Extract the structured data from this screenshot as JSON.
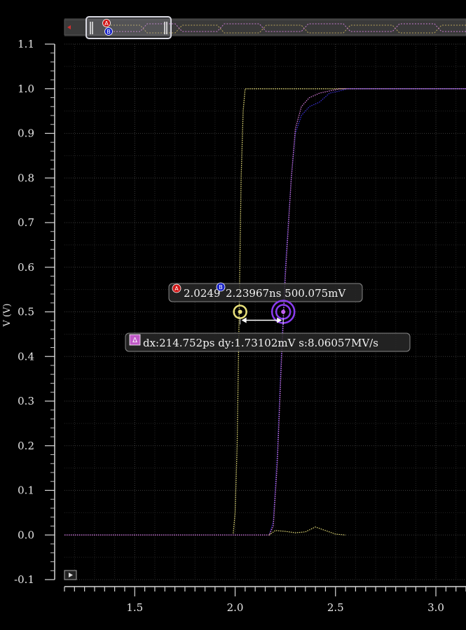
{
  "chart_data": {
    "type": "line",
    "ylabel": "V (V)",
    "xlabel": "",
    "xlim": [
      1.15,
      3.15
    ],
    "ylim": [
      -0.1,
      1.1
    ],
    "x_ticks": [
      "1.5",
      "2.0",
      "2.5",
      "3.0"
    ],
    "y_ticks": [
      "-0.1",
      "0.0",
      "0.1",
      "0.2",
      "0.3",
      "0.4",
      "0.5",
      "0.6",
      "0.7",
      "0.8",
      "0.9",
      "1.0",
      "1.1"
    ],
    "grid": true,
    "series": [
      {
        "color": "#e8e07a",
        "x": [
          1.15,
          1.99,
          2.0,
          2.01,
          2.02,
          2.03,
          2.04,
          2.05,
          3.15
        ],
        "y": [
          0.0,
          0.0,
          0.05,
          0.2,
          0.5,
          0.8,
          0.95,
          1.0,
          1.0
        ]
      },
      {
        "color": "#3a2fd6",
        "x": [
          1.15,
          2.17,
          2.19,
          2.21,
          2.23,
          2.25,
          2.28,
          2.3,
          2.33,
          2.37,
          2.42,
          2.47,
          2.52,
          2.56,
          2.6,
          3.15
        ],
        "y": [
          0.0,
          0.0,
          0.03,
          0.18,
          0.4,
          0.6,
          0.8,
          0.9,
          0.94,
          0.96,
          0.97,
          0.99,
          0.995,
          1.0,
          1.0,
          1.0
        ]
      },
      {
        "color": "#d27ad8",
        "x": [
          1.15,
          2.17,
          2.19,
          2.21,
          2.23,
          2.25,
          2.28,
          2.3,
          2.33,
          2.37,
          2.42,
          2.47,
          2.52,
          2.56,
          2.6,
          3.15
        ],
        "y": [
          0.0,
          0.0,
          0.02,
          0.16,
          0.38,
          0.58,
          0.8,
          0.91,
          0.96,
          0.98,
          0.99,
          0.995,
          1.0,
          1.0,
          1.0,
          1.0
        ]
      }
    ],
    "ripple": {
      "color": "#e8e07a",
      "x": [
        2.17,
        2.2,
        2.25,
        2.3,
        2.35,
        2.4,
        2.45,
        2.5,
        2.55
      ],
      "y": [
        0.0,
        0.01,
        0.008,
        0.005,
        0.007,
        0.018,
        0.01,
        0.002,
        0.0
      ]
    },
    "markers": {
      "a": {
        "x": 2.02492,
        "y": 0.5,
        "color": "#e8e07a"
      },
      "b": {
        "x": 2.23967,
        "y": 0.500075,
        "color": "#8a3cf0"
      }
    },
    "labels": {
      "a_badge": "A",
      "b_badge": "B",
      "a_text": "2.0249",
      "b_text": "2.23967ns 500.075mV",
      "delta_badge": "Δ",
      "delta_text": "dx:214.752ps dy:1.73102mV s:8.06057MV/s"
    }
  }
}
